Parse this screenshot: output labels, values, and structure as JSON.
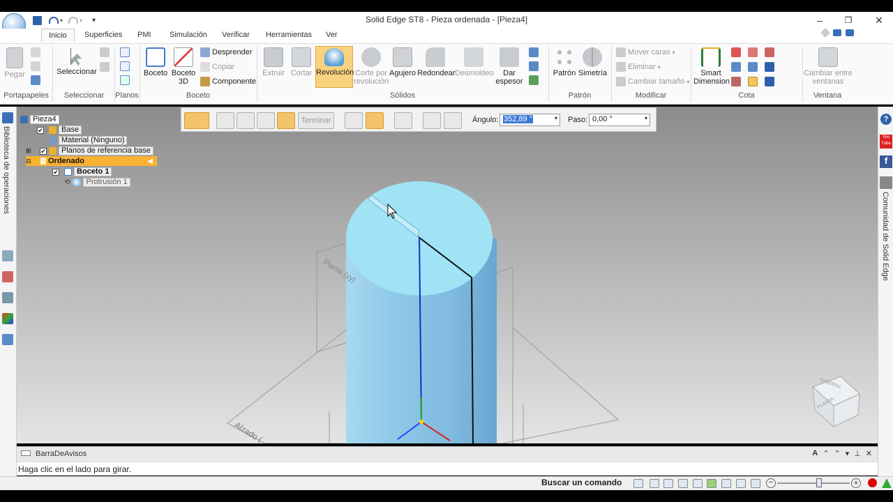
{
  "window": {
    "title": "Solid Edge ST8 - Pieza ordenada - [Pieza4]",
    "minimize": "–",
    "restore": "❐",
    "close": "✕"
  },
  "qat": {
    "dropdown": "▾"
  },
  "tabs": [
    "Inicio",
    "Superficies",
    "PMI",
    "Simulación",
    "Verificar",
    "Herramientas",
    "Ver"
  ],
  "ribbon": {
    "groups": {
      "portapapeles": "Portapapeles",
      "seleccionar": "Seleccionar",
      "planos": "Planos",
      "boceto": "Boceto",
      "solidos": "Sólidos",
      "patron": "Patrón",
      "modificar": "Modificar",
      "cota": "Cota",
      "ventana": "Ventana"
    },
    "pegar": "Pegar",
    "seleccionar": "Seleccionar",
    "boceto": "Boceto",
    "boceto3d_1": "Boceto",
    "boceto3d_2": "3D",
    "desprender": "Desprender",
    "copiar": "Copiar",
    "componente": "Componente",
    "extruir": "Extruir",
    "cortar": "Cortar",
    "revolucion": "Revolución",
    "corte_rev_1": "Corte por",
    "corte_rev_2": "revolución",
    "agujero": "Agujero",
    "redondear": "Redondear",
    "desmoldeo": "Desmoldeo",
    "dar_espesor_1": "Dar",
    "dar_espesor_2": "espesor",
    "patron": "Patrón",
    "simetria": "Simetría",
    "mover_caras": "Mover caras",
    "eliminar": "Eliminar",
    "cambiar_tamano": "Cambiar tamaño",
    "smart_dim_1": "Smart",
    "smart_dim_2": "Dimension",
    "cambiar_ventanas_1": "Cambiar entre",
    "cambiar_ventanas_2": "ventanas"
  },
  "command_bar": {
    "terminar": "Terminar",
    "angulo_label": "Ángulo:",
    "angulo_value": "352,89 °",
    "paso_label": "Paso:",
    "paso_value": "0,00 °"
  },
  "tree": {
    "root": "Pieza4",
    "base": "Base",
    "material": "Material (Ninguno)",
    "planos": "Planos de referencia base",
    "ordenado": "Ordenado",
    "boceto": "Boceto 1",
    "protrusion": "Protrusión 1"
  },
  "left_panel": {
    "label": "Biblioteca de operaciones"
  },
  "right_panel": {
    "label": "Comunidad de Solid Edge",
    "youtube": "You Tube",
    "facebook": "f"
  },
  "viewport": {
    "plane_label_1": "Planta (xy)",
    "plane_label_2": "Alzado (",
    "cube_top": "PLANTA",
    "cube_side": "TRASERA"
  },
  "notification": {
    "title": "BarraDeAvisos",
    "prompt": "Haga clic en el lado para girar."
  },
  "status": {
    "search_label": "Buscar un comando"
  },
  "colors": {
    "accent": "#f4c46a",
    "part": "#8fd3ec",
    "selection": "#3a78d6"
  }
}
